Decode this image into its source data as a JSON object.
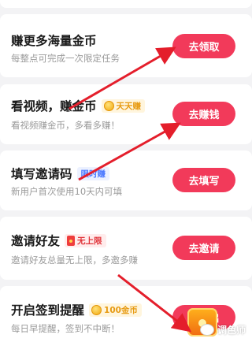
{
  "tasks": [
    {
      "title": "赚更多海量金币",
      "subtitle": "每整点可完成一次限定任务",
      "button": "去领取",
      "badge": null
    },
    {
      "title": "看视频，赚金币",
      "subtitle": "看视频赚金币，多看多赚！",
      "button": "去赚钱",
      "badge": {
        "icon": "coin-icon",
        "text": "天天赚",
        "color": "#e79a11"
      }
    },
    {
      "title": "填写邀请码",
      "subtitle": "新用户首次使用10天内可填",
      "button": "去填写",
      "badge": {
        "icon": null,
        "text": "限时赚",
        "color": "#4a78ff"
      }
    },
    {
      "title": "邀请好友",
      "subtitle": "邀请好友总量无上限，多邀多赚",
      "button": "去邀请",
      "badge": {
        "icon": "red-packet-icon",
        "text": "无上限",
        "color": "#e0343a"
      }
    },
    {
      "title": "开启签到提醒",
      "subtitle": "每日早提醒，签到不中断！",
      "button": "去开启",
      "badge": {
        "icon": "coin-icon",
        "text": "100金币",
        "color": "#e79a11"
      }
    }
  ],
  "watermark": {
    "text": "调色师"
  },
  "colors": {
    "accent": "#f23a5a",
    "arrow": "#e41e2b",
    "background": "#f3f3f5"
  }
}
